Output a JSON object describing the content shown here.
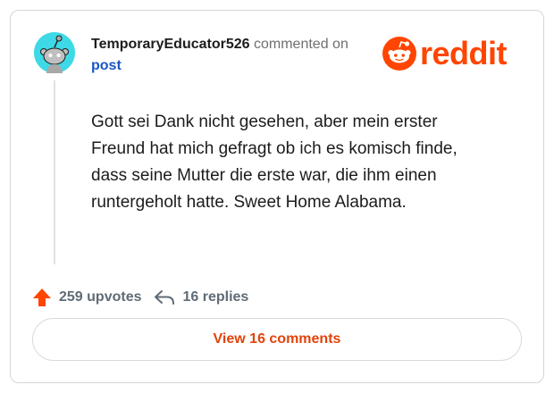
{
  "comment": {
    "username": "TemporaryEducator526",
    "action_text": "commented on",
    "post_link": "post",
    "body": "Gott sei Dank nicht gesehen, aber mein erster Freund hat mich gefragt ob ich es komisch finde, dass seine Mutter die erste war, die ihm einen runtergeholt hatte. Sweet Home Alabama."
  },
  "brand": {
    "wordmark": "reddit",
    "color": "#ff4500"
  },
  "stats": {
    "upvotes": "259 upvotes",
    "replies": "16 replies"
  },
  "actions": {
    "view_comments_label": "View 16 comments"
  },
  "icons": {
    "avatar": "snoo-avatar-icon",
    "logo": "reddit-snoo-icon",
    "upvote": "upvote-arrow-icon",
    "reply": "reply-arrow-icon"
  },
  "colors": {
    "accent": "#ff4500",
    "link": "#1a56c4",
    "button_text": "#e2430a",
    "avatar_bg": "#3dd9e6",
    "muted": "#5f6b76"
  }
}
